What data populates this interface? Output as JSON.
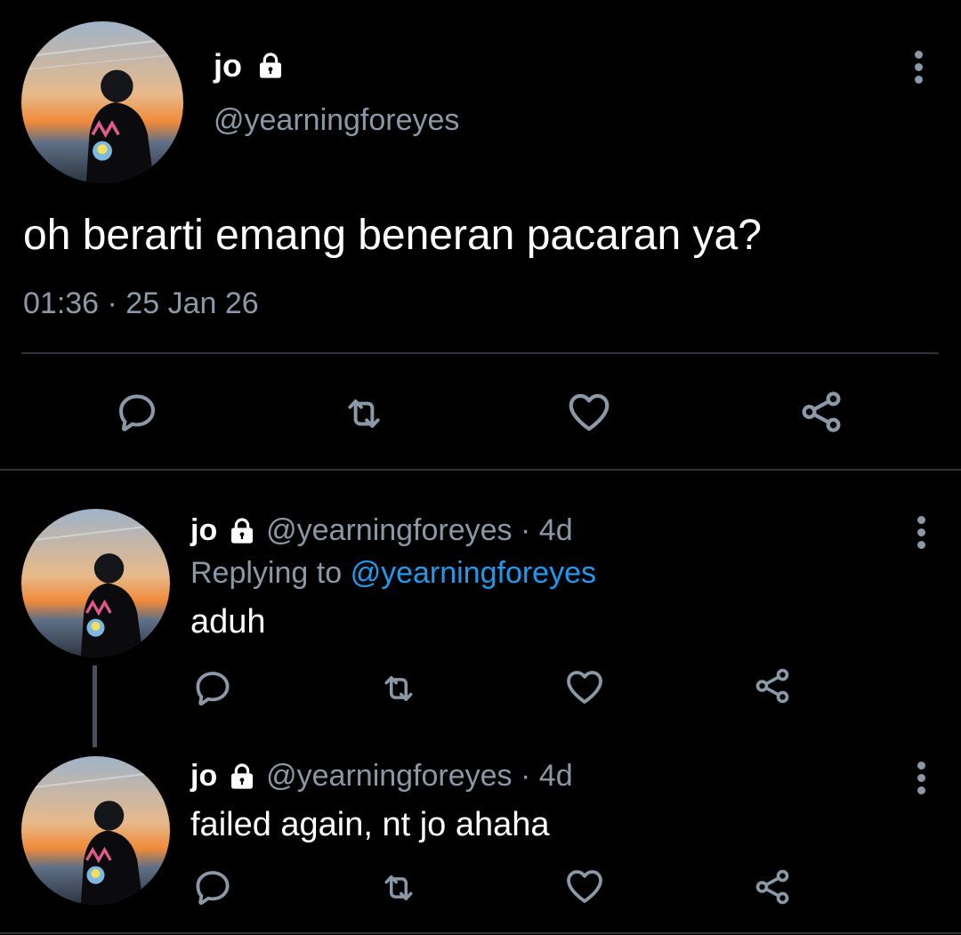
{
  "main_tweet": {
    "display_name": "jo",
    "handle": "@yearningforeyes",
    "text": "oh berarti emang beneran pacaran ya?",
    "timestamp": "01:36 · 25 Jan 26"
  },
  "replies": [
    {
      "display_name": "jo",
      "handle": "@yearningforeyes",
      "age": "· 4d",
      "replying_prefix": "Replying to",
      "replying_handle": "@yearningforeyes",
      "text": "aduh"
    },
    {
      "display_name": "jo",
      "handle": "@yearningforeyes",
      "age": "· 4d",
      "text": "failed again, nt jo ahaha"
    }
  ],
  "icons": [
    "lock-icon",
    "more-icon",
    "reply-icon",
    "retweet-icon",
    "like-icon",
    "share-icon"
  ],
  "colors": {
    "background": "#000000",
    "text": "#e7e9ea",
    "muted": "#8b98a5",
    "link": "#1d9bf0",
    "divider": "#2f3336"
  }
}
